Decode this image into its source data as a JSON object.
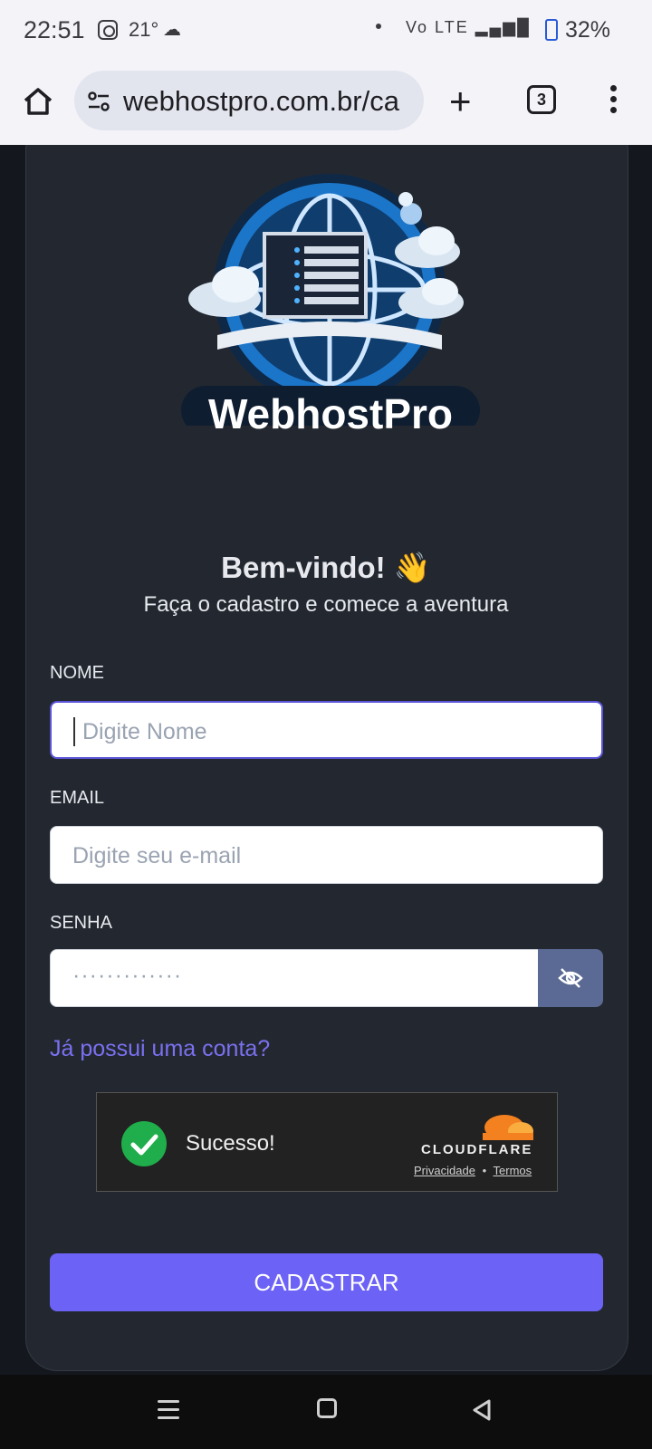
{
  "status_bar": {
    "time": "22:51",
    "temperature": "21°",
    "network_icons": "Vo LTE ▂▄▆█",
    "battery_percent": "32%",
    "icons": [
      "instagram-icon",
      "weather-icon",
      "wifi-call-icon",
      "signal-icon",
      "battery-charging-icon"
    ]
  },
  "browser": {
    "url": "webhostpro.com.br/ca",
    "tab_count": "3",
    "icons": [
      "home-icon",
      "site-settings-icon",
      "new-tab-icon",
      "tabs-icon",
      "more-icon"
    ]
  },
  "logo": {
    "brand": "WebhostPro"
  },
  "form": {
    "welcome": "Bem-vindo! 👋",
    "subtitle": "Faça o cadastro e comece a aventura",
    "name_label": "NOME",
    "name_placeholder": "Digite Nome",
    "email_label": "EMAIL",
    "email_placeholder": "Digite seu e-mail",
    "password_label": "SENHA",
    "password_value": "·············",
    "login_link": "Já possui uma conta?",
    "submit": "CADASTRAR"
  },
  "captcha": {
    "status": "Sucesso!",
    "brand": "CLOUDFLARE",
    "privacy": "Privacidade",
    "separator": "•",
    "terms": "Termos"
  },
  "colors": {
    "accent": "#6c63f6",
    "link": "#7b70f0",
    "success": "#1fae4b",
    "cloudflare": "#f48120"
  }
}
